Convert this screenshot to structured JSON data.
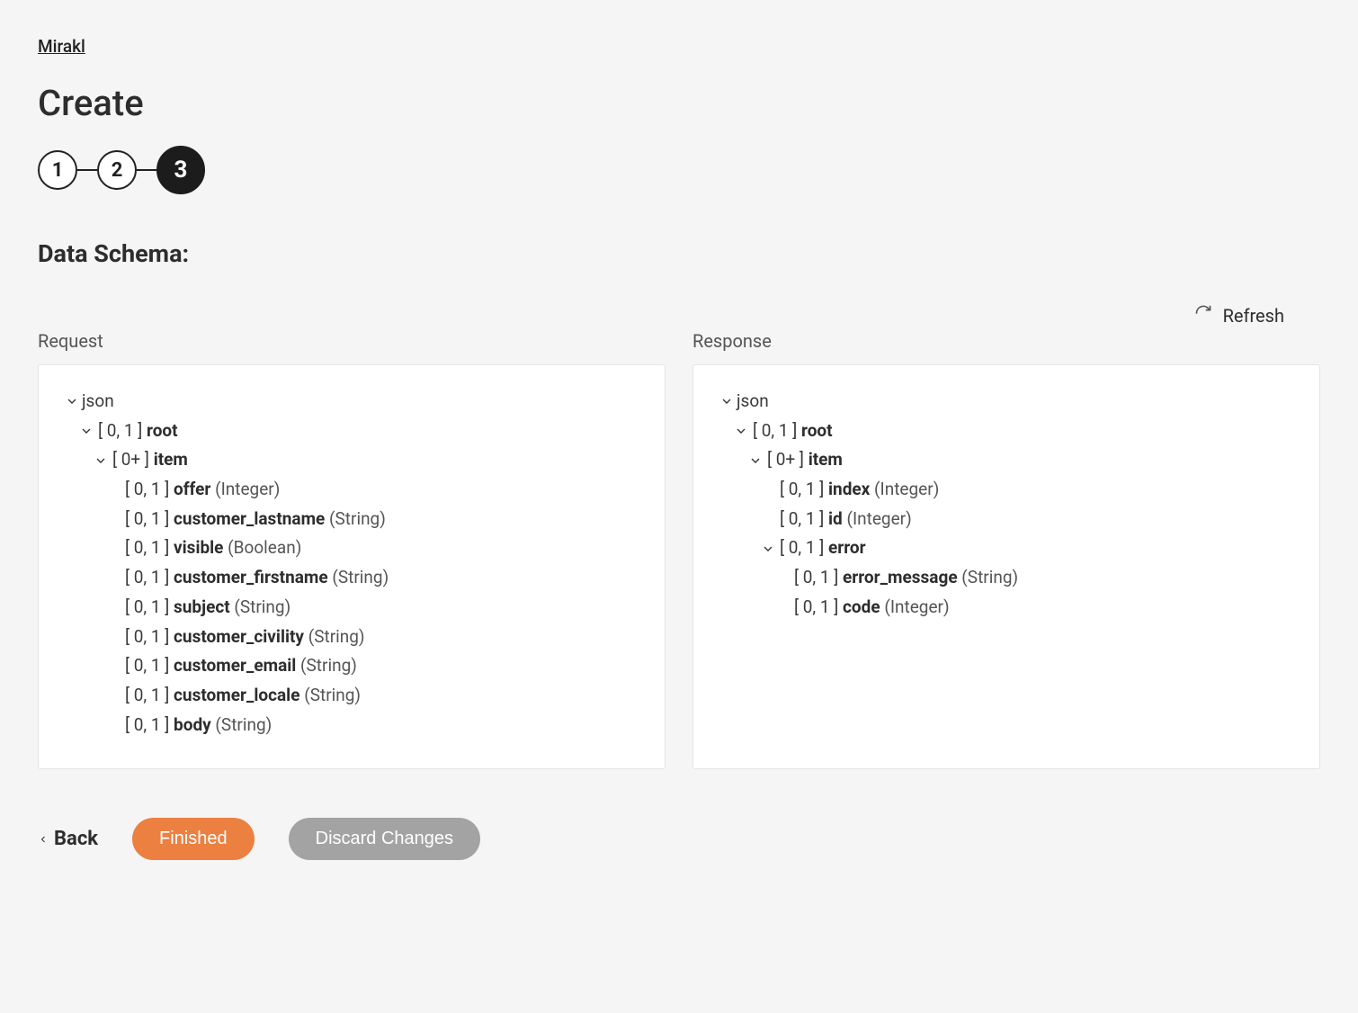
{
  "breadcrumb": {
    "link": "Mirakl"
  },
  "page": {
    "title": "Create"
  },
  "stepper": {
    "steps": [
      {
        "label": "1",
        "active": false
      },
      {
        "label": "2",
        "active": false
      },
      {
        "label": "3",
        "active": true
      }
    ]
  },
  "section": {
    "title": "Data Schema:"
  },
  "refresh": {
    "label": "Refresh"
  },
  "panels": {
    "request": {
      "label": "Request",
      "tree": [
        {
          "depth": 0,
          "toggle": true,
          "card": "",
          "name": "json",
          "name_bold": false,
          "type": ""
        },
        {
          "depth": 1,
          "toggle": true,
          "card": "[ 0, 1 ]",
          "name": "root",
          "name_bold": true,
          "type": ""
        },
        {
          "depth": 2,
          "toggle": true,
          "card": "[ 0+ ]",
          "name": "item",
          "name_bold": true,
          "type": ""
        },
        {
          "depth": 3,
          "toggle": false,
          "card": "[ 0, 1 ]",
          "name": "offer",
          "name_bold": true,
          "type": "(Integer)"
        },
        {
          "depth": 3,
          "toggle": false,
          "card": "[ 0, 1 ]",
          "name": "customer_lastname",
          "name_bold": true,
          "type": "(String)"
        },
        {
          "depth": 3,
          "toggle": false,
          "card": "[ 0, 1 ]",
          "name": "visible",
          "name_bold": true,
          "type": "(Boolean)"
        },
        {
          "depth": 3,
          "toggle": false,
          "card": "[ 0, 1 ]",
          "name": "customer_firstname",
          "name_bold": true,
          "type": "(String)"
        },
        {
          "depth": 3,
          "toggle": false,
          "card": "[ 0, 1 ]",
          "name": "subject",
          "name_bold": true,
          "type": "(String)"
        },
        {
          "depth": 3,
          "toggle": false,
          "card": "[ 0, 1 ]",
          "name": "customer_civility",
          "name_bold": true,
          "type": "(String)"
        },
        {
          "depth": 3,
          "toggle": false,
          "card": "[ 0, 1 ]",
          "name": "customer_email",
          "name_bold": true,
          "type": "(String)"
        },
        {
          "depth": 3,
          "toggle": false,
          "card": "[ 0, 1 ]",
          "name": "customer_locale",
          "name_bold": true,
          "type": "(String)"
        },
        {
          "depth": 3,
          "toggle": false,
          "card": "[ 0, 1 ]",
          "name": "body",
          "name_bold": true,
          "type": "(String)"
        }
      ]
    },
    "response": {
      "label": "Response",
      "tree": [
        {
          "depth": 0,
          "toggle": true,
          "card": "",
          "name": "json",
          "name_bold": false,
          "type": ""
        },
        {
          "depth": 1,
          "toggle": true,
          "card": "[ 0, 1 ]",
          "name": "root",
          "name_bold": true,
          "type": ""
        },
        {
          "depth": 2,
          "toggle": true,
          "card": "[ 0+ ]",
          "name": "item",
          "name_bold": true,
          "type": ""
        },
        {
          "depth": 3,
          "toggle": false,
          "card": "[ 0, 1 ]",
          "name": "index",
          "name_bold": true,
          "type": "(Integer)"
        },
        {
          "depth": 3,
          "toggle": false,
          "card": "[ 0, 1 ]",
          "name": "id",
          "name_bold": true,
          "type": "(Integer)"
        },
        {
          "depth": 3,
          "toggle": true,
          "card": "[ 0, 1 ]",
          "name": "error",
          "name_bold": true,
          "type": ""
        },
        {
          "depth": 4,
          "toggle": false,
          "card": "[ 0, 1 ]",
          "name": "error_message",
          "name_bold": true,
          "type": "(String)"
        },
        {
          "depth": 4,
          "toggle": false,
          "card": "[ 0, 1 ]",
          "name": "code",
          "name_bold": true,
          "type": "(Integer)"
        }
      ]
    }
  },
  "footer": {
    "back": "Back",
    "finished": "Finished",
    "discard": "Discard Changes"
  }
}
